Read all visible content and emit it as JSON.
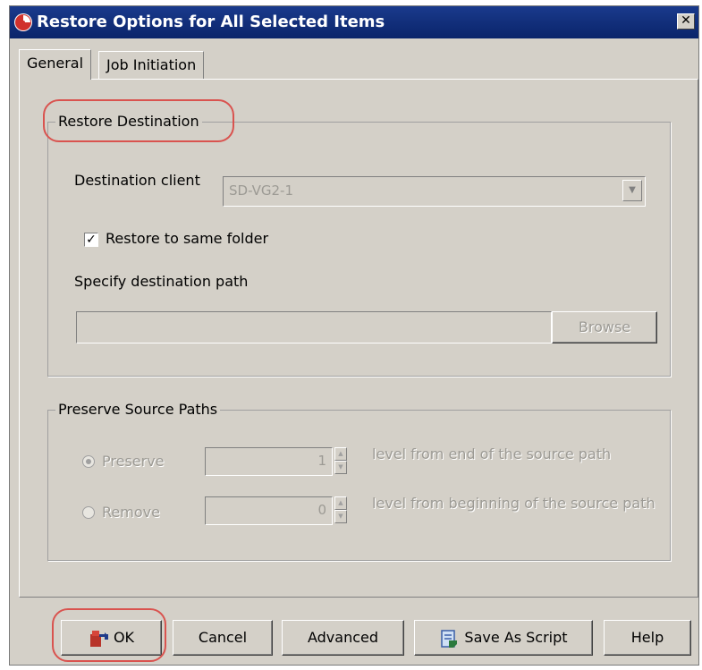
{
  "window": {
    "title": "Restore Options for All Selected Items",
    "close_label": "✕"
  },
  "tabs": [
    {
      "label": "General",
      "active": true
    },
    {
      "label": "Job Initiation",
      "active": false
    }
  ],
  "restore_destination": {
    "title": "Restore Destination",
    "destination_client_label": "Destination client",
    "destination_client_value": "SD-VG2-1",
    "restore_same_folder_label": "Restore to same folder",
    "restore_same_folder_checked": true,
    "specify_path_label": "Specify destination path",
    "path_value": "",
    "browse_label": "Browse"
  },
  "preserve_source_paths": {
    "title": "Preserve Source Paths",
    "preserve_label": "Preserve",
    "preserve_value": "1",
    "preserve_suffix": "level from end of the source path",
    "remove_label": "Remove",
    "remove_value": "0",
    "remove_suffix": "level from beginning of the source path",
    "selected": "preserve"
  },
  "buttons": {
    "ok": "OK",
    "cancel": "Cancel",
    "advanced": "Advanced",
    "save_as_script": "Save As Script",
    "help": "Help"
  },
  "colors": {
    "titlebar": "#0a246a",
    "dialog_bg": "#d4d0c8",
    "highlight": "#d9534f",
    "disabled_text": "#9c9a94"
  }
}
